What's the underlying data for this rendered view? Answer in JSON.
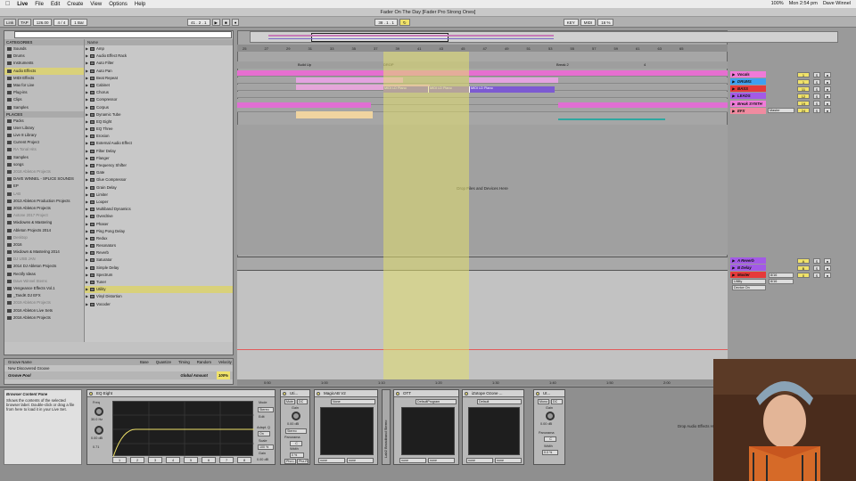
{
  "menubar": {
    "apple": "",
    "items": [
      "Live",
      "File",
      "Edit",
      "Create",
      "View",
      "Options",
      "Help"
    ],
    "battery": "100%",
    "clock": "Mon 2:54 pm",
    "user": "Dave Winnel"
  },
  "window": {
    "title": "Fader On The Day  [Fader Pro Strong Ones]"
  },
  "transport": {
    "link": "Link",
    "tap": "TAP",
    "tempo": "126.00",
    "signature": "4 / 4",
    "quantize": "1 Bar",
    "position": "41 . 2 . 1",
    "loop_start": "38 . 1 . 1",
    "key": "KEY",
    "midi": "MIDI",
    "cpu": "16 %"
  },
  "browser": {
    "categories_header": "CATEGORIES",
    "categories": [
      "Sounds",
      "Drums",
      "Instruments",
      "Audio Effects",
      "MIDI Effects",
      "Max for Live",
      "Plug-ins",
      "Clips",
      "Samples"
    ],
    "selected_category": "Audio Effects",
    "places_header": "PLACES",
    "places": [
      "Packs",
      "User Library",
      "Live 8 Library",
      "Current Project",
      "RA Tonal Hits",
      "Samples",
      "songs",
      "2018 Ableton Projects",
      "DAVE WINNEL - SPLICE SOUNDS",
      "EP",
      "LAB",
      "2013 Ableton Production Projects",
      "2015 Ableton Projects",
      "Axtone 2017 Project",
      "Mixdowns & Mastering",
      "Ableton Projects 2014",
      "Desktop",
      "2016",
      "Mixdown & Mastering 2014",
      "DJ USB JAN",
      "2014 DJ Ableton Projects",
      "Rectify Ideas",
      "Dave Winnel Stems",
      "Vengeance Effects Vol.1",
      "_TandK DJ EFX",
      "2019 Ableton Projects",
      "2016 Ableton Live Sets",
      "2016 Ableton Projects"
    ],
    "files_header": "Name",
    "files": [
      "Amp",
      "Audio Effect Rack",
      "Auto Filter",
      "Auto Pan",
      "Beat Repeat",
      "Cabinet",
      "Chorus",
      "Compressor",
      "Corpus",
      "Dynamic Tube",
      "EQ Eight",
      "EQ Three",
      "Erosion",
      "External Audio Effect",
      "Filter Delay",
      "Flanger",
      "Frequency Shifter",
      "Gate",
      "Glue Compressor",
      "Grain Delay",
      "Limiter",
      "Looper",
      "Multiband Dynamics",
      "Overdrive",
      "Phaser",
      "Ping Pong Delay",
      "Redux",
      "Resonators",
      "Reverb",
      "Saturator",
      "Simple Delay",
      "Spectrum",
      "Tuner",
      "Utility",
      "Vinyl Distortion",
      "Vocoder"
    ],
    "selected_file": "Utility"
  },
  "groove": {
    "headers": [
      "Groove Name",
      "Base",
      "Quantize",
      "Timing",
      "Random",
      "Velocity"
    ],
    "row": "New Discovered Groove",
    "pool_label": "Groove Pool",
    "global_amount_label": "Global Amount",
    "global_amount": "100%"
  },
  "arrangement": {
    "ruler": [
      "25",
      "27",
      "29",
      "31",
      "33",
      "35",
      "37",
      "39",
      "41",
      "43",
      "45",
      "47",
      "49",
      "51",
      "53",
      "55",
      "57",
      "59",
      "61",
      "63",
      "65"
    ],
    "locators": [
      "Build Up",
      "DROP",
      "Break 2",
      "4"
    ],
    "midi_clips": [
      "MIDI LD Piano",
      "MIDI LD Piano",
      "MIDI LD Piano"
    ],
    "drop_text": "Drop Files and Devices Here",
    "bottom_ruler": [
      "0:50",
      "1:00",
      "1:10",
      "1:20",
      "1:30",
      "1:40",
      "1:50",
      "2:00"
    ]
  },
  "tracks": [
    {
      "name": "Vocals",
      "num": "1",
      "color": "#f07ad8"
    },
    {
      "name": "DRUMS",
      "num": "1",
      "color": "#3fa0f0"
    },
    {
      "name": "BASS",
      "num": "11",
      "color": "#e53a3a"
    },
    {
      "name": "LEADS",
      "num": "12",
      "color": "#a35ae6"
    },
    {
      "name": "Break SYNTH",
      "num": "19",
      "color": "#f07ad8"
    },
    {
      "name": "EFX",
      "num": "24",
      "color": "#f08ba0",
      "route": "Master"
    }
  ],
  "returns": [
    {
      "name": "A Reverb",
      "num": "A",
      "color": "#a35ae6"
    },
    {
      "name": "B Delay",
      "num": "B",
      "color": "#a35ae6"
    }
  ],
  "master": {
    "name": "Master",
    "num": "0",
    "color": "#e53a3a",
    "device": "Utility",
    "mode": "Device On",
    "sig1": "8/16",
    "sig2": "8/16"
  },
  "info": {
    "title": "Browser Content Pane",
    "text": "Shows the contents of the selected browser label. Double-click or drag a file from here to load it in your Live Set."
  },
  "devices": [
    {
      "name": "EQ Eight",
      "mode": "Mode",
      "mode_val": "Stereo",
      "freq": "30.0 Hz",
      "gain": "0.00 dB",
      "q": "0.71",
      "edit": "Edit",
      "scale": "Scale",
      "scale_val": "100 %",
      "out": "Gain",
      "out_val": "0.00 dB",
      "adapt": "Adapt. Q",
      "adapt_val": "On"
    },
    {
      "name": "Uti...",
      "mute": "Mute",
      "dc": "DC",
      "gain": "Gain",
      "gain_val": "0.00 dB",
      "stereo": "Stereo",
      "pan": "Panorama",
      "pan_val": "C",
      "width": "Width",
      "width_val": "0 %",
      "left": "Phz-L",
      "right": "Phz-R"
    },
    {
      "name": "MagicAB V2",
      "preset": "None"
    },
    {
      "name": "OTT",
      "preset": "DefaultProgram"
    },
    {
      "name": "iZotope Ozone ...",
      "preset": "Default"
    },
    {
      "name": "Ut...",
      "mode": "Mono",
      "dc": "DC",
      "gain": "Gain",
      "gain_val": "0.00 dB",
      "pan": "Panorama",
      "pan_val": "C",
      "width": "Width",
      "width_val": "0.0 %"
    }
  ],
  "side_labels": {
    "audio_effect": "Audio Effect",
    "lab2": "Lab2 Broadband Stereo"
  },
  "drop_audio": "Drop Audio Effects Here"
}
